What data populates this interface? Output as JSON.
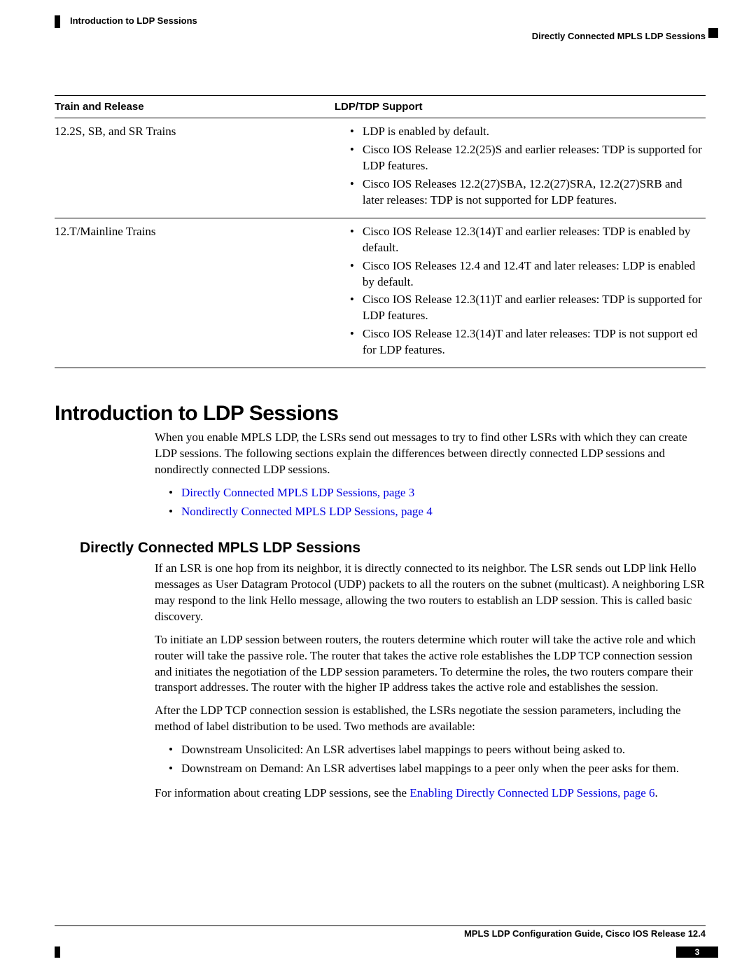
{
  "header": {
    "title": "Introduction to LDP Sessions",
    "subtitle": "Directly Connected MPLS LDP Sessions"
  },
  "table": {
    "col1": "Train and Release",
    "col2": "LDP/TDP Support",
    "rows": [
      {
        "train": "12.2S, SB, and SR Trains",
        "items": [
          "LDP is enabled by default.",
          "Cisco IOS Release 12.2(25)S and earlier releases: TDP is supported for LDP features.",
          "Cisco IOS Releases 12.2(27)SBA, 12.2(27)SRA, 12.2(27)SRB and later releases: TDP is not supported for LDP features."
        ]
      },
      {
        "train": "12.T/Mainline Trains",
        "items": [
          "Cisco IOS Release 12.3(14)T and earlier releases: TDP is enabled by default.",
          "Cisco IOS Releases 12.4 and 12.4T and later releases: LDP is enabled by default.",
          "Cisco IOS Release 12.3(11)T and earlier releases: TDP is supported for LDP features.",
          "Cisco IOS Release 12.3(14)T and later releases: TDP is not support ed for LDP features."
        ]
      }
    ]
  },
  "section": {
    "heading": "Introduction to LDP Sessions",
    "intro": "When you enable MPLS LDP, the LSRs send out messages to try to find other LSRs with which they can create LDP sessions. The following sections explain the differences between directly connected LDP sessions and nondirectly connected LDP sessions.",
    "links": [
      "Directly Connected MPLS LDP Sessions,  page 3",
      "Nondirectly Connected MPLS LDP Sessions,  page 4"
    ]
  },
  "subsection": {
    "heading": "Directly Connected MPLS LDP Sessions",
    "p1": "If an LSR is one hop from its neighbor, it is directly connected to its neighbor. The LSR sends out LDP link Hello messages as User Datagram Protocol (UDP) packets to all the routers on the subnet (multicast). A neighboring LSR may respond to the link Hello message, allowing the two routers to establish an LDP session. This is called basic discovery.",
    "p2": "To initiate an LDP session between routers, the routers determine which router will take the active role and which router will take the passive role. The router that takes the active role establishes the LDP TCP connection session and initiates the negotiation of the LDP session parameters. To determine the roles, the two routers compare their transport addresses. The router with the higher IP address takes the active role and establishes the session.",
    "p3": "After the LDP TCP connection session is established, the LSRs negotiate the session parameters, including the method of label distribution to be used. Two methods are available:",
    "bullets": [
      "Downstream Unsolicited: An LSR advertises label mappings to peers without being asked to.",
      "Downstream on Demand: An LSR advertises label mappings to a peer only when the peer asks for them."
    ],
    "p4_prefix": "For information about creating LDP sessions, see the ",
    "p4_link": "Enabling Directly Connected LDP Sessions,  page 6",
    "p4_suffix": "."
  },
  "footer": {
    "title": "MPLS LDP Configuration Guide, Cisco IOS Release 12.4",
    "page": "3"
  }
}
